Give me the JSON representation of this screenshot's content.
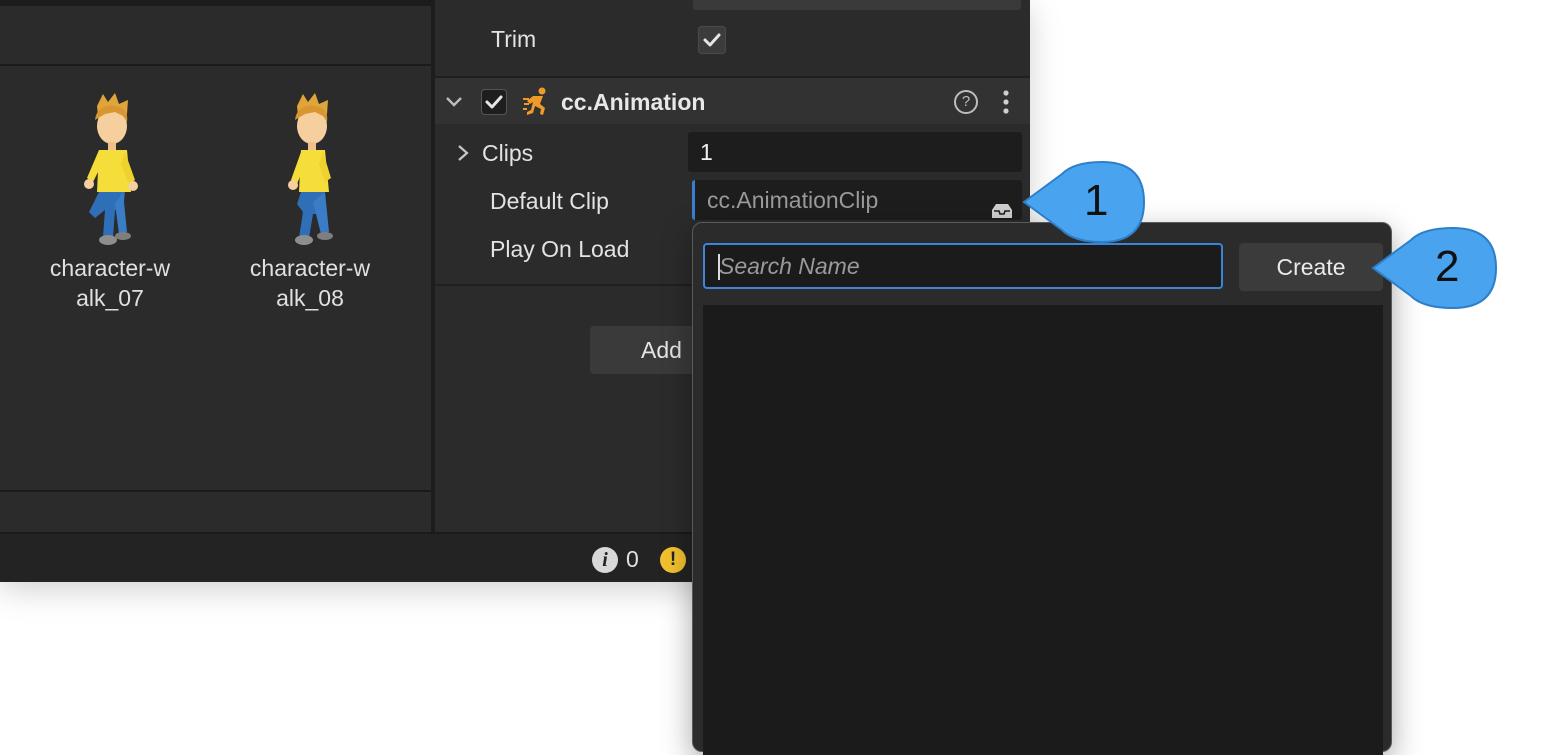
{
  "assets": {
    "items": [
      {
        "name_line1": "character-w",
        "name_line2": "alk_07"
      },
      {
        "name_line1": "character-w",
        "name_line2": "alk_08"
      }
    ]
  },
  "inspector": {
    "trim_label": "Trim",
    "trim_checked": true,
    "component": {
      "title": "cc.Animation",
      "enabled": true,
      "help_symbol": "?"
    },
    "clips_label": "Clips",
    "clips_value": "1",
    "default_clip_label": "Default Clip",
    "default_clip_placeholder": "cc.AnimationClip",
    "play_on_load_label": "Play On Load",
    "add_button_label": "Add"
  },
  "statusbar": {
    "info_count": "0",
    "info_icon": "i",
    "warn_icon": "!"
  },
  "popup": {
    "search_placeholder": "Search Name",
    "create_label": "Create"
  },
  "callouts": {
    "first": "1",
    "second": "2"
  },
  "colors": {
    "accent_blue": "#3b86d8",
    "callout_blue": "#4aa3ee",
    "warning_yellow": "#f2c12e",
    "component_orange": "#f09a2a"
  }
}
